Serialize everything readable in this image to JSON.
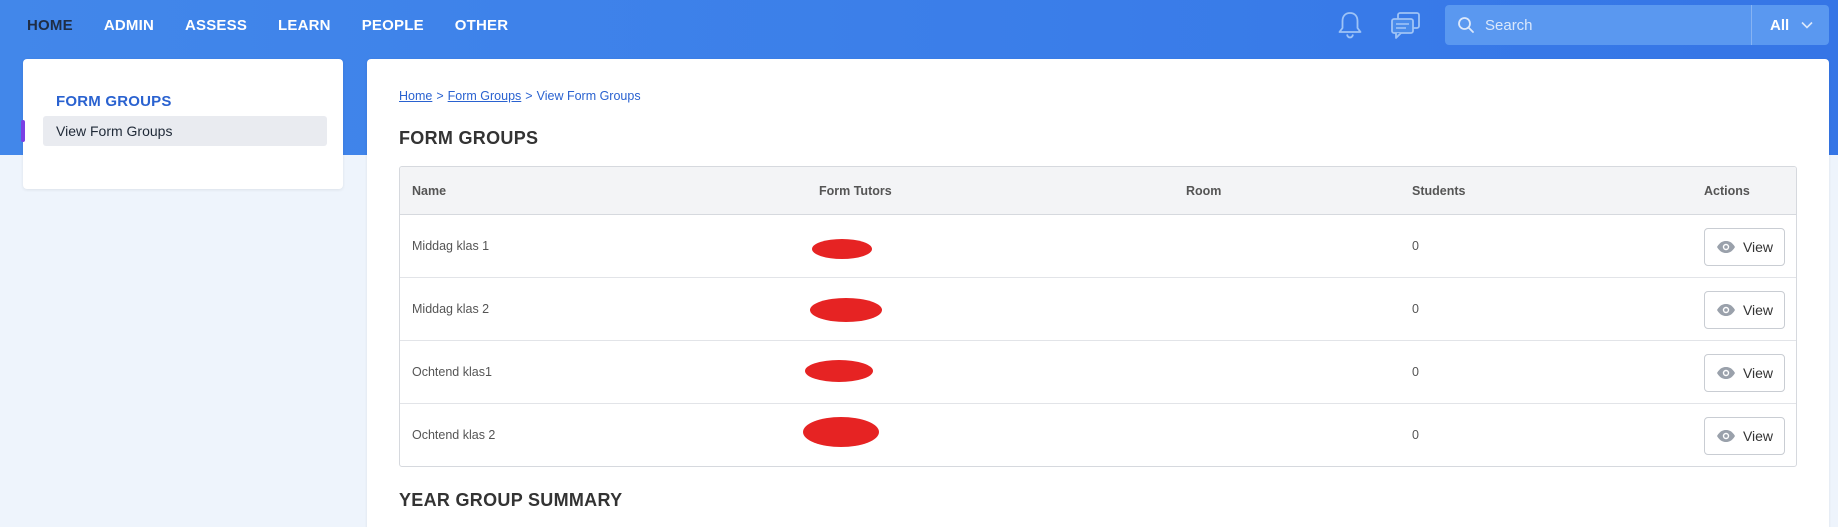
{
  "nav": {
    "items": [
      {
        "label": "HOME",
        "active": true
      },
      {
        "label": "ADMIN",
        "active": false
      },
      {
        "label": "ASSESS",
        "active": false
      },
      {
        "label": "LEARN",
        "active": false
      },
      {
        "label": "PEOPLE",
        "active": false
      },
      {
        "label": "OTHER",
        "active": false
      }
    ],
    "notification_icon": "bell-icon",
    "messages_icon": "chat-bubbles-icon",
    "search": {
      "placeholder": "Search",
      "value": ""
    },
    "scope": {
      "selected": "All"
    }
  },
  "sidebar": {
    "title": "FORM GROUPS",
    "items": [
      {
        "label": "View Form Groups",
        "active": true
      }
    ]
  },
  "breadcrumb": {
    "items": [
      "Home",
      "Form Groups",
      "View Form Groups"
    ]
  },
  "main": {
    "title": "FORM GROUPS",
    "table": {
      "columns": [
        "Name",
        "Form Tutors",
        "Room",
        "Students",
        "Actions"
      ],
      "rows": [
        {
          "name": "Middag klas 1",
          "tutor": "",
          "room": "",
          "students": "0",
          "action": "View"
        },
        {
          "name": "Middag klas 2",
          "tutor": "",
          "room": "",
          "students": "0",
          "action": "View"
        },
        {
          "name": "Ochtend klas1",
          "tutor": "",
          "room": "",
          "students": "0",
          "action": "View"
        },
        {
          "name": "Ochtend klas 2",
          "tutor": "",
          "room": "",
          "students": "0",
          "action": "View"
        }
      ]
    },
    "summary_title": "YEAR GROUP SUMMARY"
  },
  "colors": {
    "header": "#3a7de9",
    "accent": "#2a62d0",
    "active_bar": "#7b3fe4",
    "redaction": "#e62323"
  }
}
